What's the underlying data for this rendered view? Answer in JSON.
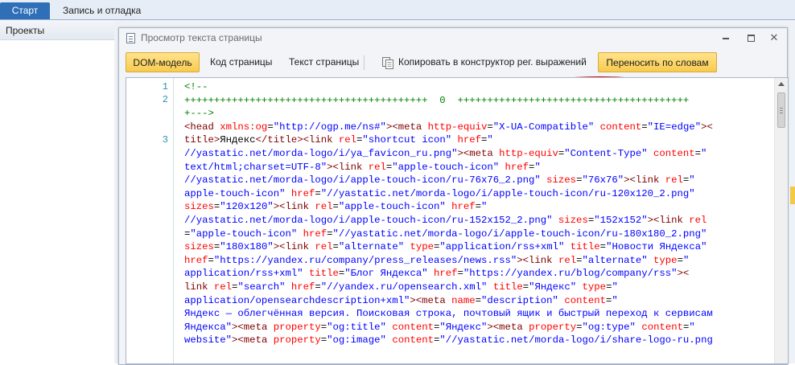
{
  "top_tabs": [
    {
      "label": "Старт",
      "active": true
    },
    {
      "label": "Запись и отладка",
      "active": false
    }
  ],
  "left_pane": {
    "header": "Проекты"
  },
  "dialog": {
    "title": "Просмотр текста страницы",
    "toolbar": {
      "dom_model": "DOM-модель",
      "page_code": "Код страницы",
      "page_text": "Текст страницы",
      "copy_to_regex": "Копировать в конструктор рег. выражений",
      "word_wrap": "Переносить по словам"
    },
    "line_numbers": [
      "1",
      "2",
      "3"
    ],
    "code_lines": [
      [
        {
          "t": "c",
          "s": "<!--"
        }
      ],
      [
        {
          "t": "c",
          "s": "+++++++++++++++++++++++++++++++++++++++++  0  +++++++++++++++++++++++++++++++++++++++"
        }
      ],
      [
        {
          "t": "c",
          "s": "+--->"
        }
      ],
      [
        {
          "t": "g",
          "s": "<head "
        },
        {
          "t": "a",
          "s": "xmlns:og"
        },
        {
          "t": "x",
          "s": "="
        },
        {
          "t": "v",
          "s": "\"http://ogp.me/ns#\""
        },
        {
          "t": "g",
          "s": "><meta "
        },
        {
          "t": "a",
          "s": "http-equiv"
        },
        {
          "t": "x",
          "s": "="
        },
        {
          "t": "v",
          "s": "\"X-UA-Compatible\""
        },
        {
          "t": "x",
          "s": " "
        },
        {
          "t": "a",
          "s": "content"
        },
        {
          "t": "x",
          "s": "="
        },
        {
          "t": "v",
          "s": "\"IE=edge\""
        },
        {
          "t": "g",
          "s": "><"
        }
      ],
      [
        {
          "t": "g",
          "s": "title>"
        },
        {
          "t": "x",
          "s": "Яндекс"
        },
        {
          "t": "g",
          "s": "</title><link "
        },
        {
          "t": "a",
          "s": "rel"
        },
        {
          "t": "x",
          "s": "="
        },
        {
          "t": "v",
          "s": "\"shortcut icon\""
        },
        {
          "t": "x",
          "s": " "
        },
        {
          "t": "a",
          "s": "href"
        },
        {
          "t": "x",
          "s": "="
        },
        {
          "t": "v",
          "s": "\""
        }
      ],
      [
        {
          "t": "v",
          "s": "//yastatic.net/morda-logo/i/ya_favicon_ru.png\""
        },
        {
          "t": "g",
          "s": "><meta "
        },
        {
          "t": "a",
          "s": "http-equiv"
        },
        {
          "t": "x",
          "s": "="
        },
        {
          "t": "v",
          "s": "\"Content-Type\""
        },
        {
          "t": "x",
          "s": " "
        },
        {
          "t": "a",
          "s": "content"
        },
        {
          "t": "x",
          "s": "="
        },
        {
          "t": "v",
          "s": "\""
        }
      ],
      [
        {
          "t": "v",
          "s": "text/html;charset=UTF-8\""
        },
        {
          "t": "g",
          "s": "><link "
        },
        {
          "t": "a",
          "s": "rel"
        },
        {
          "t": "x",
          "s": "="
        },
        {
          "t": "v",
          "s": "\"apple-touch-icon\""
        },
        {
          "t": "x",
          "s": " "
        },
        {
          "t": "a",
          "s": "href"
        },
        {
          "t": "x",
          "s": "="
        },
        {
          "t": "v",
          "s": "\""
        }
      ],
      [
        {
          "t": "v",
          "s": "//yastatic.net/morda-logo/i/apple-touch-icon/ru-76x76_2.png\""
        },
        {
          "t": "x",
          "s": " "
        },
        {
          "t": "a",
          "s": "sizes"
        },
        {
          "t": "x",
          "s": "="
        },
        {
          "t": "v",
          "s": "\"76x76\""
        },
        {
          "t": "g",
          "s": "><link "
        },
        {
          "t": "a",
          "s": "rel"
        },
        {
          "t": "x",
          "s": "="
        },
        {
          "t": "v",
          "s": "\""
        }
      ],
      [
        {
          "t": "v",
          "s": "apple-touch-icon\""
        },
        {
          "t": "x",
          "s": " "
        },
        {
          "t": "a",
          "s": "href"
        },
        {
          "t": "x",
          "s": "="
        },
        {
          "t": "v",
          "s": "\"//yastatic.net/morda-logo/i/apple-touch-icon/ru-120x120_2.png\""
        }
      ],
      [
        {
          "t": "a",
          "s": "sizes"
        },
        {
          "t": "x",
          "s": "="
        },
        {
          "t": "v",
          "s": "\"120x120\""
        },
        {
          "t": "g",
          "s": "><link "
        },
        {
          "t": "a",
          "s": "rel"
        },
        {
          "t": "x",
          "s": "="
        },
        {
          "t": "v",
          "s": "\"apple-touch-icon\""
        },
        {
          "t": "x",
          "s": " "
        },
        {
          "t": "a",
          "s": "href"
        },
        {
          "t": "x",
          "s": "="
        },
        {
          "t": "v",
          "s": "\""
        }
      ],
      [
        {
          "t": "v",
          "s": "//yastatic.net/morda-logo/i/apple-touch-icon/ru-152x152_2.png\""
        },
        {
          "t": "x",
          "s": " "
        },
        {
          "t": "a",
          "s": "sizes"
        },
        {
          "t": "x",
          "s": "="
        },
        {
          "t": "v",
          "s": "\"152x152\""
        },
        {
          "t": "g",
          "s": "><link "
        },
        {
          "t": "a",
          "s": "rel"
        }
      ],
      [
        {
          "t": "x",
          "s": "="
        },
        {
          "t": "v",
          "s": "\"apple-touch-icon\""
        },
        {
          "t": "x",
          "s": " "
        },
        {
          "t": "a",
          "s": "href"
        },
        {
          "t": "x",
          "s": "="
        },
        {
          "t": "v",
          "s": "\"//yastatic.net/morda-logo/i/apple-touch-icon/ru-180x180_2.png\""
        }
      ],
      [
        {
          "t": "a",
          "s": "sizes"
        },
        {
          "t": "x",
          "s": "="
        },
        {
          "t": "v",
          "s": "\"180x180\""
        },
        {
          "t": "g",
          "s": "><link "
        },
        {
          "t": "a",
          "s": "rel"
        },
        {
          "t": "x",
          "s": "="
        },
        {
          "t": "v",
          "s": "\"alternate\""
        },
        {
          "t": "x",
          "s": " "
        },
        {
          "t": "a",
          "s": "type"
        },
        {
          "t": "x",
          "s": "="
        },
        {
          "t": "v",
          "s": "\"application/rss+xml\""
        },
        {
          "t": "x",
          "s": " "
        },
        {
          "t": "a",
          "s": "title"
        },
        {
          "t": "x",
          "s": "="
        },
        {
          "t": "v",
          "s": "\"Новости Яндекса\""
        }
      ],
      [
        {
          "t": "a",
          "s": "href"
        },
        {
          "t": "x",
          "s": "="
        },
        {
          "t": "v",
          "s": "\"https://yandex.ru/company/press_releases/news.rss\""
        },
        {
          "t": "g",
          "s": "><link "
        },
        {
          "t": "a",
          "s": "rel"
        },
        {
          "t": "x",
          "s": "="
        },
        {
          "t": "v",
          "s": "\"alternate\""
        },
        {
          "t": "x",
          "s": " "
        },
        {
          "t": "a",
          "s": "type"
        },
        {
          "t": "x",
          "s": "="
        },
        {
          "t": "v",
          "s": "\""
        }
      ],
      [
        {
          "t": "v",
          "s": "application/rss+xml\""
        },
        {
          "t": "x",
          "s": " "
        },
        {
          "t": "a",
          "s": "title"
        },
        {
          "t": "x",
          "s": "="
        },
        {
          "t": "v",
          "s": "\"Блог Яндекса\""
        },
        {
          "t": "x",
          "s": " "
        },
        {
          "t": "a",
          "s": "href"
        },
        {
          "t": "x",
          "s": "="
        },
        {
          "t": "v",
          "s": "\"https://yandex.ru/blog/company/rss\""
        },
        {
          "t": "g",
          "s": "><"
        }
      ],
      [
        {
          "t": "g",
          "s": "link "
        },
        {
          "t": "a",
          "s": "rel"
        },
        {
          "t": "x",
          "s": "="
        },
        {
          "t": "v",
          "s": "\"search\""
        },
        {
          "t": "x",
          "s": " "
        },
        {
          "t": "a",
          "s": "href"
        },
        {
          "t": "x",
          "s": "="
        },
        {
          "t": "v",
          "s": "\"//yandex.ru/opensearch.xml\""
        },
        {
          "t": "x",
          "s": " "
        },
        {
          "t": "a",
          "s": "title"
        },
        {
          "t": "x",
          "s": "="
        },
        {
          "t": "v",
          "s": "\"Яндекс\""
        },
        {
          "t": "x",
          "s": " "
        },
        {
          "t": "a",
          "s": "type"
        },
        {
          "t": "x",
          "s": "="
        },
        {
          "t": "v",
          "s": "\""
        }
      ],
      [
        {
          "t": "v",
          "s": "application/opensearchdescription+xml\""
        },
        {
          "t": "g",
          "s": "><meta "
        },
        {
          "t": "a",
          "s": "name"
        },
        {
          "t": "x",
          "s": "="
        },
        {
          "t": "v",
          "s": "\"description\""
        },
        {
          "t": "x",
          "s": " "
        },
        {
          "t": "a",
          "s": "content"
        },
        {
          "t": "x",
          "s": "="
        },
        {
          "t": "v",
          "s": "\""
        }
      ],
      [
        {
          "t": "v",
          "s": "Яндекс — облегчённая версия. Поисковая строка, почтовый ящик и быстрый переход к сервисам"
        }
      ],
      [
        {
          "t": "v",
          "s": "Яндекса\""
        },
        {
          "t": "g",
          "s": "><meta "
        },
        {
          "t": "a",
          "s": "property"
        },
        {
          "t": "x",
          "s": "="
        },
        {
          "t": "v",
          "s": "\"og:title\""
        },
        {
          "t": "x",
          "s": " "
        },
        {
          "t": "a",
          "s": "content"
        },
        {
          "t": "x",
          "s": "="
        },
        {
          "t": "v",
          "s": "\"Яндекс\""
        },
        {
          "t": "g",
          "s": "><meta "
        },
        {
          "t": "a",
          "s": "property"
        },
        {
          "t": "x",
          "s": "="
        },
        {
          "t": "v",
          "s": "\"og:type\""
        },
        {
          "t": "x",
          "s": " "
        },
        {
          "t": "a",
          "s": "content"
        },
        {
          "t": "x",
          "s": "="
        },
        {
          "t": "v",
          "s": "\""
        }
      ],
      [
        {
          "t": "v",
          "s": "website\""
        },
        {
          "t": "g",
          "s": "><meta "
        },
        {
          "t": "a",
          "s": "property"
        },
        {
          "t": "x",
          "s": "="
        },
        {
          "t": "v",
          "s": "\"og:image\""
        },
        {
          "t": "x",
          "s": " "
        },
        {
          "t": "a",
          "s": "content"
        },
        {
          "t": "x",
          "s": "="
        },
        {
          "t": "v",
          "s": "\"//yastatic.net/morda-logo/i/share-logo-ru.png"
        }
      ]
    ]
  },
  "colors": {
    "comment": "#008000",
    "tag": "#800000",
    "attribute": "#ff0000",
    "value": "#0000ff",
    "line_number": "#2b91af",
    "highlight_button": "#f8cb50",
    "annotation_ellipse": "#d31313"
  }
}
